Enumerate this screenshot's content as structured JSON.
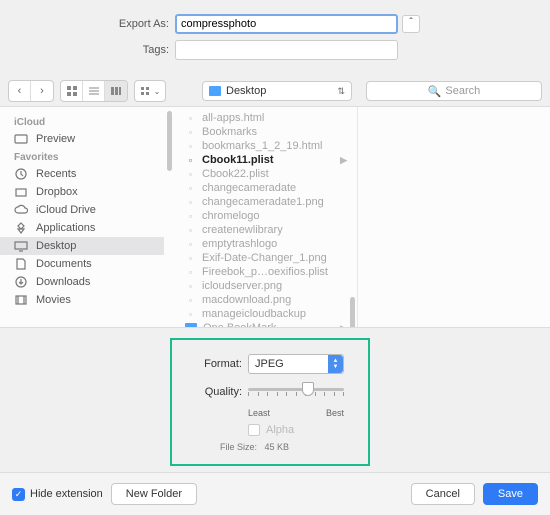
{
  "top": {
    "export_label": "Export As:",
    "export_value": "compressphoto",
    "tags_label": "Tags:"
  },
  "toolbar": {
    "path_location": "Desktop",
    "search_placeholder": "Search"
  },
  "sidebar": {
    "h1": "iCloud",
    "icloud_items": [
      "Preview"
    ],
    "h2": "Favorites",
    "fav_items": [
      "Recents",
      "Dropbox",
      "iCloud Drive",
      "Applications",
      "Desktop",
      "Documents",
      "Downloads",
      "Movies"
    ],
    "selected": "Desktop"
  },
  "files": [
    {
      "name": "all-apps.html",
      "kind": "file"
    },
    {
      "name": "Bookmarks",
      "kind": "file"
    },
    {
      "name": "bookmarks_1_2_19.html",
      "kind": "file"
    },
    {
      "name": "Cbook11.plist",
      "kind": "file",
      "sel": true,
      "arrow": true
    },
    {
      "name": "Cbook22.plist",
      "kind": "file"
    },
    {
      "name": "changecameradate",
      "kind": "file"
    },
    {
      "name": "changecameradate1.png",
      "kind": "file"
    },
    {
      "name": "chromelogo",
      "kind": "file"
    },
    {
      "name": "createnewlibrary",
      "kind": "file"
    },
    {
      "name": "emptytrashlogo",
      "kind": "file"
    },
    {
      "name": "Exif-Date-Changer_1.png",
      "kind": "file"
    },
    {
      "name": "Fireebok_p…oexifios.plist",
      "kind": "file"
    },
    {
      "name": "icloudserver.png",
      "kind": "file"
    },
    {
      "name": "macdownload.png",
      "kind": "file"
    },
    {
      "name": "manageicloudbackup",
      "kind": "file"
    },
    {
      "name": "One BookMark",
      "kind": "folder",
      "arrow": true
    }
  ],
  "format": {
    "label_format": "Format:",
    "value_format": "JPEG",
    "label_quality": "Quality:",
    "slider_pos_percent": 62,
    "least": "Least",
    "best": "Best",
    "alpha": "Alpha",
    "filesize_label": "File Size:",
    "filesize_value": "45 KB"
  },
  "bottom": {
    "hide_ext": "Hide extension",
    "new_folder": "New Folder",
    "cancel": "Cancel",
    "save": "Save"
  }
}
